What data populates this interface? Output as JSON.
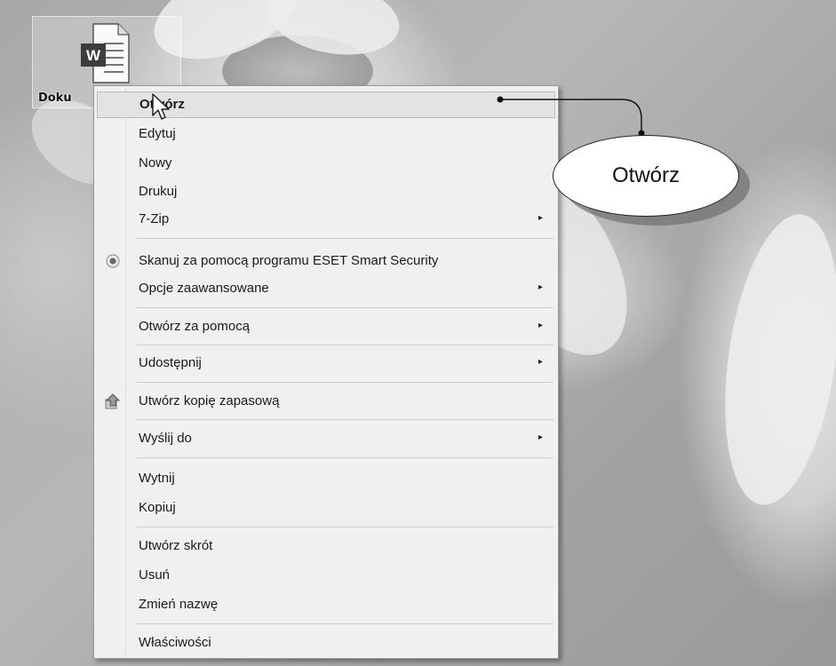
{
  "desktop": {
    "icon_label": "Doku"
  },
  "context_menu": {
    "items": [
      {
        "label": "Otwórz"
      },
      {
        "label": "Edytuj"
      },
      {
        "label": "Nowy"
      },
      {
        "label": "Drukuj"
      },
      {
        "label": "7-Zip",
        "submenu": true
      },
      {
        "label": "Skanuj za pomocą programu ESET Smart Security",
        "icon": "eset-scan-icon"
      },
      {
        "label": "Opcje zaawansowane",
        "submenu": true
      },
      {
        "label": "Otwórz za pomocą",
        "submenu": true
      },
      {
        "label": "Udostępnij",
        "submenu": true
      },
      {
        "label": "Utwórz kopię zapasową",
        "icon": "backup-icon"
      },
      {
        "label": "Wyślij do",
        "submenu": true
      },
      {
        "label": "Wytnij"
      },
      {
        "label": "Kopiuj"
      },
      {
        "label": "Utwórz skrót"
      },
      {
        "label": "Usuń"
      },
      {
        "label": "Zmień nazwę"
      },
      {
        "label": "Właściwości"
      }
    ],
    "submenu_arrow": "▸"
  },
  "callout": {
    "text": "Otwórz"
  }
}
